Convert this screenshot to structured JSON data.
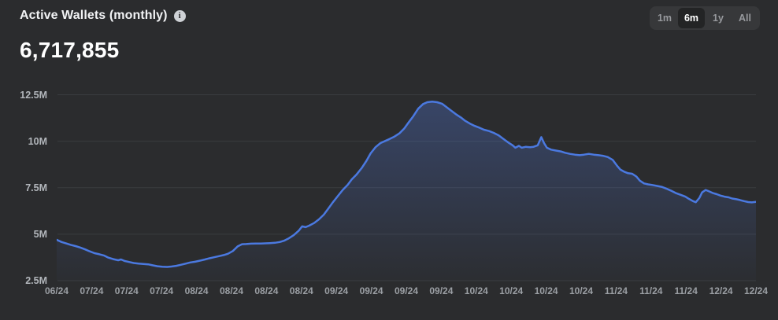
{
  "header": {
    "title": "Active Wallets (monthly)",
    "info_icon_glyph": "i",
    "value": "6,717,855"
  },
  "range_selector": {
    "options": [
      "1m",
      "6m",
      "1y",
      "All"
    ],
    "selected": "6m"
  },
  "colors": {
    "background": "#2b2c2e",
    "line": "#4b79e0",
    "fill_top": "rgba(86,128,235,0.30)",
    "fill_bottom": "rgba(86,128,235,0.02)",
    "gridline": "#3a3c3f",
    "y_axis_text": "#b2b6bb",
    "x_axis_text": "#9b9fa4",
    "title_text": "#f2f3f5",
    "value_text": "#ffffff"
  },
  "chart_data": {
    "type": "area",
    "title": "Active Wallets (monthly)",
    "current_value": 6717855,
    "grid": "horizontal",
    "legend": "none",
    "ylim_millions": [
      2.5,
      13.0
    ],
    "y_ticks": [
      {
        "label": "2.5M",
        "value_millions": 2.5
      },
      {
        "label": "5M",
        "value_millions": 5
      },
      {
        "label": "7.5M",
        "value_millions": 7.5
      },
      {
        "label": "10M",
        "value_millions": 10
      },
      {
        "label": "12.5M",
        "value_millions": 12.5
      }
    ],
    "x_tick_labels": [
      "06/24",
      "07/24",
      "07/24",
      "07/24",
      "08/24",
      "08/24",
      "08/24",
      "08/24",
      "09/24",
      "09/24",
      "09/24",
      "09/24",
      "10/24",
      "10/24",
      "10/24",
      "10/24",
      "11/24",
      "11/24",
      "11/24",
      "12/24",
      "12/24"
    ],
    "series": [
      {
        "name": "Active Wallets (monthly)",
        "points_x_fraction_value_millions": [
          [
            0.0,
            4.7
          ],
          [
            0.007,
            4.58
          ],
          [
            0.014,
            4.5
          ],
          [
            0.02,
            4.43
          ],
          [
            0.027,
            4.36
          ],
          [
            0.034,
            4.28
          ],
          [
            0.041,
            4.18
          ],
          [
            0.047,
            4.08
          ],
          [
            0.054,
            3.98
          ],
          [
            0.061,
            3.92
          ],
          [
            0.068,
            3.85
          ],
          [
            0.074,
            3.74
          ],
          [
            0.081,
            3.66
          ],
          [
            0.088,
            3.6
          ],
          [
            0.092,
            3.64
          ],
          [
            0.097,
            3.56
          ],
          [
            0.104,
            3.5
          ],
          [
            0.11,
            3.45
          ],
          [
            0.117,
            3.42
          ],
          [
            0.124,
            3.4
          ],
          [
            0.131,
            3.38
          ],
          [
            0.137,
            3.33
          ],
          [
            0.144,
            3.28
          ],
          [
            0.151,
            3.25
          ],
          [
            0.158,
            3.24
          ],
          [
            0.164,
            3.26
          ],
          [
            0.171,
            3.3
          ],
          [
            0.178,
            3.36
          ],
          [
            0.185,
            3.42
          ],
          [
            0.191,
            3.48
          ],
          [
            0.198,
            3.52
          ],
          [
            0.205,
            3.58
          ],
          [
            0.212,
            3.64
          ],
          [
            0.218,
            3.7
          ],
          [
            0.225,
            3.76
          ],
          [
            0.232,
            3.82
          ],
          [
            0.239,
            3.88
          ],
          [
            0.245,
            3.95
          ],
          [
            0.252,
            4.1
          ],
          [
            0.259,
            4.35
          ],
          [
            0.265,
            4.46
          ],
          [
            0.271,
            4.47
          ],
          [
            0.278,
            4.49
          ],
          [
            0.285,
            4.5
          ],
          [
            0.292,
            4.5
          ],
          [
            0.298,
            4.51
          ],
          [
            0.305,
            4.52
          ],
          [
            0.312,
            4.54
          ],
          [
            0.319,
            4.58
          ],
          [
            0.325,
            4.65
          ],
          [
            0.332,
            4.78
          ],
          [
            0.339,
            4.95
          ],
          [
            0.346,
            5.18
          ],
          [
            0.351,
            5.42
          ],
          [
            0.356,
            5.38
          ],
          [
            0.361,
            5.46
          ],
          [
            0.368,
            5.6
          ],
          [
            0.375,
            5.8
          ],
          [
            0.382,
            6.05
          ],
          [
            0.388,
            6.35
          ],
          [
            0.395,
            6.72
          ],
          [
            0.402,
            7.05
          ],
          [
            0.409,
            7.38
          ],
          [
            0.416,
            7.65
          ],
          [
            0.422,
            7.95
          ],
          [
            0.429,
            8.22
          ],
          [
            0.436,
            8.55
          ],
          [
            0.443,
            8.95
          ],
          [
            0.449,
            9.35
          ],
          [
            0.456,
            9.68
          ],
          [
            0.463,
            9.9
          ],
          [
            0.47,
            10.02
          ],
          [
            0.476,
            10.12
          ],
          [
            0.483,
            10.25
          ],
          [
            0.49,
            10.42
          ],
          [
            0.497,
            10.68
          ],
          [
            0.503,
            11.0
          ],
          [
            0.51,
            11.35
          ],
          [
            0.517,
            11.75
          ],
          [
            0.524,
            12.0
          ],
          [
            0.53,
            12.1
          ],
          [
            0.537,
            12.13
          ],
          [
            0.544,
            12.1
          ],
          [
            0.551,
            12.02
          ],
          [
            0.557,
            11.85
          ],
          [
            0.564,
            11.65
          ],
          [
            0.571,
            11.45
          ],
          [
            0.578,
            11.28
          ],
          [
            0.584,
            11.1
          ],
          [
            0.591,
            10.95
          ],
          [
            0.598,
            10.82
          ],
          [
            0.605,
            10.72
          ],
          [
            0.611,
            10.62
          ],
          [
            0.618,
            10.55
          ],
          [
            0.625,
            10.45
          ],
          [
            0.632,
            10.32
          ],
          [
            0.638,
            10.15
          ],
          [
            0.645,
            9.95
          ],
          [
            0.652,
            9.78
          ],
          [
            0.656,
            9.65
          ],
          [
            0.661,
            9.75
          ],
          [
            0.665,
            9.65
          ],
          [
            0.671,
            9.7
          ],
          [
            0.677,
            9.68
          ],
          [
            0.682,
            9.7
          ],
          [
            0.688,
            9.78
          ],
          [
            0.693,
            10.22
          ],
          [
            0.697,
            9.9
          ],
          [
            0.701,
            9.65
          ],
          [
            0.707,
            9.55
          ],
          [
            0.714,
            9.5
          ],
          [
            0.721,
            9.45
          ],
          [
            0.727,
            9.38
          ],
          [
            0.734,
            9.32
          ],
          [
            0.741,
            9.28
          ],
          [
            0.748,
            9.25
          ],
          [
            0.754,
            9.28
          ],
          [
            0.761,
            9.32
          ],
          [
            0.768,
            9.28
          ],
          [
            0.775,
            9.25
          ],
          [
            0.781,
            9.22
          ],
          [
            0.788,
            9.15
          ],
          [
            0.795,
            9.0
          ],
          [
            0.801,
            8.7
          ],
          [
            0.806,
            8.48
          ],
          [
            0.812,
            8.35
          ],
          [
            0.817,
            8.28
          ],
          [
            0.823,
            8.25
          ],
          [
            0.829,
            8.1
          ],
          [
            0.834,
            7.88
          ],
          [
            0.84,
            7.73
          ],
          [
            0.846,
            7.68
          ],
          [
            0.851,
            7.65
          ],
          [
            0.858,
            7.6
          ],
          [
            0.865,
            7.55
          ],
          [
            0.872,
            7.45
          ],
          [
            0.878,
            7.35
          ],
          [
            0.885,
            7.22
          ],
          [
            0.892,
            7.12
          ],
          [
            0.899,
            7.02
          ],
          [
            0.904,
            6.9
          ],
          [
            0.91,
            6.78
          ],
          [
            0.914,
            6.72
          ],
          [
            0.919,
            6.95
          ],
          [
            0.923,
            7.25
          ],
          [
            0.928,
            7.38
          ],
          [
            0.932,
            7.32
          ],
          [
            0.938,
            7.22
          ],
          [
            0.944,
            7.15
          ],
          [
            0.949,
            7.08
          ],
          [
            0.955,
            7.02
          ],
          [
            0.961,
            6.98
          ],
          [
            0.966,
            6.92
          ],
          [
            0.972,
            6.88
          ],
          [
            0.977,
            6.84
          ],
          [
            0.983,
            6.78
          ],
          [
            0.989,
            6.73
          ],
          [
            0.994,
            6.71
          ],
          [
            1.0,
            6.74
          ]
        ]
      }
    ]
  }
}
